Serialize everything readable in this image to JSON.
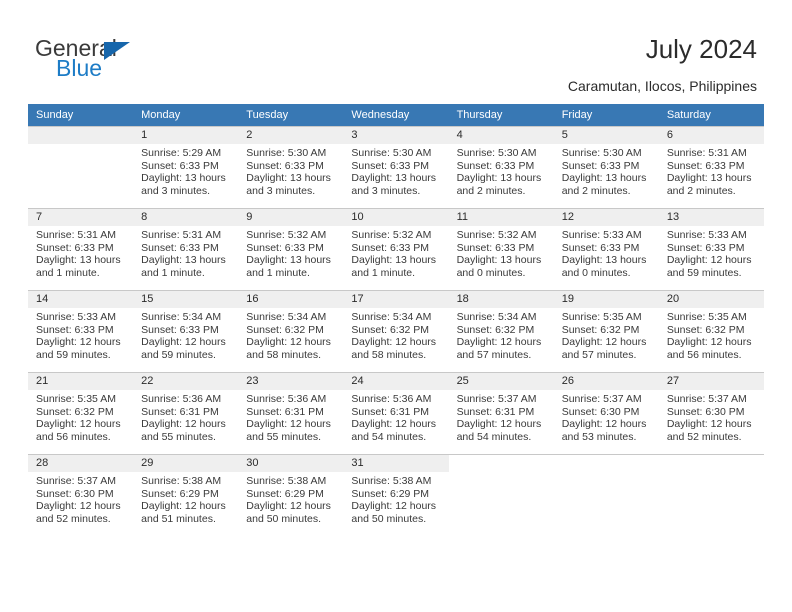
{
  "brand": {
    "name_top": "General",
    "name_bottom": "Blue",
    "color_blue": "#1d7cc6",
    "color_triangle": "#1766ab",
    "color_dark": "#3a3a3a"
  },
  "header": {
    "title": "July 2024",
    "subtitle": "Caramutan, Ilocos, Philippines"
  },
  "theme": {
    "header_bg": "#3878b4",
    "header_text": "#ffffff",
    "daynum_band": "#efefef",
    "grid_line": "#c8c8c8"
  },
  "weekday_headers": [
    "Sunday",
    "Monday",
    "Tuesday",
    "Wednesday",
    "Thursday",
    "Friday",
    "Saturday"
  ],
  "weeks": [
    [
      {
        "day": "",
        "sunrise": "",
        "sunset": "",
        "daylight_line1": "",
        "daylight_line2": ""
      },
      {
        "day": "1",
        "sunrise": "Sunrise: 5:29 AM",
        "sunset": "Sunset: 6:33 PM",
        "daylight_line1": "Daylight: 13 hours",
        "daylight_line2": "and 3 minutes."
      },
      {
        "day": "2",
        "sunrise": "Sunrise: 5:30 AM",
        "sunset": "Sunset: 6:33 PM",
        "daylight_line1": "Daylight: 13 hours",
        "daylight_line2": "and 3 minutes."
      },
      {
        "day": "3",
        "sunrise": "Sunrise: 5:30 AM",
        "sunset": "Sunset: 6:33 PM",
        "daylight_line1": "Daylight: 13 hours",
        "daylight_line2": "and 3 minutes."
      },
      {
        "day": "4",
        "sunrise": "Sunrise: 5:30 AM",
        "sunset": "Sunset: 6:33 PM",
        "daylight_line1": "Daylight: 13 hours",
        "daylight_line2": "and 2 minutes."
      },
      {
        "day": "5",
        "sunrise": "Sunrise: 5:30 AM",
        "sunset": "Sunset: 6:33 PM",
        "daylight_line1": "Daylight: 13 hours",
        "daylight_line2": "and 2 minutes."
      },
      {
        "day": "6",
        "sunrise": "Sunrise: 5:31 AM",
        "sunset": "Sunset: 6:33 PM",
        "daylight_line1": "Daylight: 13 hours",
        "daylight_line2": "and 2 minutes."
      }
    ],
    [
      {
        "day": "7",
        "sunrise": "Sunrise: 5:31 AM",
        "sunset": "Sunset: 6:33 PM",
        "daylight_line1": "Daylight: 13 hours",
        "daylight_line2": "and 1 minute."
      },
      {
        "day": "8",
        "sunrise": "Sunrise: 5:31 AM",
        "sunset": "Sunset: 6:33 PM",
        "daylight_line1": "Daylight: 13 hours",
        "daylight_line2": "and 1 minute."
      },
      {
        "day": "9",
        "sunrise": "Sunrise: 5:32 AM",
        "sunset": "Sunset: 6:33 PM",
        "daylight_line1": "Daylight: 13 hours",
        "daylight_line2": "and 1 minute."
      },
      {
        "day": "10",
        "sunrise": "Sunrise: 5:32 AM",
        "sunset": "Sunset: 6:33 PM",
        "daylight_line1": "Daylight: 13 hours",
        "daylight_line2": "and 1 minute."
      },
      {
        "day": "11",
        "sunrise": "Sunrise: 5:32 AM",
        "sunset": "Sunset: 6:33 PM",
        "daylight_line1": "Daylight: 13 hours",
        "daylight_line2": "and 0 minutes."
      },
      {
        "day": "12",
        "sunrise": "Sunrise: 5:33 AM",
        "sunset": "Sunset: 6:33 PM",
        "daylight_line1": "Daylight: 13 hours",
        "daylight_line2": "and 0 minutes."
      },
      {
        "day": "13",
        "sunrise": "Sunrise: 5:33 AM",
        "sunset": "Sunset: 6:33 PM",
        "daylight_line1": "Daylight: 12 hours",
        "daylight_line2": "and 59 minutes."
      }
    ],
    [
      {
        "day": "14",
        "sunrise": "Sunrise: 5:33 AM",
        "sunset": "Sunset: 6:33 PM",
        "daylight_line1": "Daylight: 12 hours",
        "daylight_line2": "and 59 minutes."
      },
      {
        "day": "15",
        "sunrise": "Sunrise: 5:34 AM",
        "sunset": "Sunset: 6:33 PM",
        "daylight_line1": "Daylight: 12 hours",
        "daylight_line2": "and 59 minutes."
      },
      {
        "day": "16",
        "sunrise": "Sunrise: 5:34 AM",
        "sunset": "Sunset: 6:32 PM",
        "daylight_line1": "Daylight: 12 hours",
        "daylight_line2": "and 58 minutes."
      },
      {
        "day": "17",
        "sunrise": "Sunrise: 5:34 AM",
        "sunset": "Sunset: 6:32 PM",
        "daylight_line1": "Daylight: 12 hours",
        "daylight_line2": "and 58 minutes."
      },
      {
        "day": "18",
        "sunrise": "Sunrise: 5:34 AM",
        "sunset": "Sunset: 6:32 PM",
        "daylight_line1": "Daylight: 12 hours",
        "daylight_line2": "and 57 minutes."
      },
      {
        "day": "19",
        "sunrise": "Sunrise: 5:35 AM",
        "sunset": "Sunset: 6:32 PM",
        "daylight_line1": "Daylight: 12 hours",
        "daylight_line2": "and 57 minutes."
      },
      {
        "day": "20",
        "sunrise": "Sunrise: 5:35 AM",
        "sunset": "Sunset: 6:32 PM",
        "daylight_line1": "Daylight: 12 hours",
        "daylight_line2": "and 56 minutes."
      }
    ],
    [
      {
        "day": "21",
        "sunrise": "Sunrise: 5:35 AM",
        "sunset": "Sunset: 6:32 PM",
        "daylight_line1": "Daylight: 12 hours",
        "daylight_line2": "and 56 minutes."
      },
      {
        "day": "22",
        "sunrise": "Sunrise: 5:36 AM",
        "sunset": "Sunset: 6:31 PM",
        "daylight_line1": "Daylight: 12 hours",
        "daylight_line2": "and 55 minutes."
      },
      {
        "day": "23",
        "sunrise": "Sunrise: 5:36 AM",
        "sunset": "Sunset: 6:31 PM",
        "daylight_line1": "Daylight: 12 hours",
        "daylight_line2": "and 55 minutes."
      },
      {
        "day": "24",
        "sunrise": "Sunrise: 5:36 AM",
        "sunset": "Sunset: 6:31 PM",
        "daylight_line1": "Daylight: 12 hours",
        "daylight_line2": "and 54 minutes."
      },
      {
        "day": "25",
        "sunrise": "Sunrise: 5:37 AM",
        "sunset": "Sunset: 6:31 PM",
        "daylight_line1": "Daylight: 12 hours",
        "daylight_line2": "and 54 minutes."
      },
      {
        "day": "26",
        "sunrise": "Sunrise: 5:37 AM",
        "sunset": "Sunset: 6:30 PM",
        "daylight_line1": "Daylight: 12 hours",
        "daylight_line2": "and 53 minutes."
      },
      {
        "day": "27",
        "sunrise": "Sunrise: 5:37 AM",
        "sunset": "Sunset: 6:30 PM",
        "daylight_line1": "Daylight: 12 hours",
        "daylight_line2": "and 52 minutes."
      }
    ],
    [
      {
        "day": "28",
        "sunrise": "Sunrise: 5:37 AM",
        "sunset": "Sunset: 6:30 PM",
        "daylight_line1": "Daylight: 12 hours",
        "daylight_line2": "and 52 minutes."
      },
      {
        "day": "29",
        "sunrise": "Sunrise: 5:38 AM",
        "sunset": "Sunset: 6:29 PM",
        "daylight_line1": "Daylight: 12 hours",
        "daylight_line2": "and 51 minutes."
      },
      {
        "day": "30",
        "sunrise": "Sunrise: 5:38 AM",
        "sunset": "Sunset: 6:29 PM",
        "daylight_line1": "Daylight: 12 hours",
        "daylight_line2": "and 50 minutes."
      },
      {
        "day": "31",
        "sunrise": "Sunrise: 5:38 AM",
        "sunset": "Sunset: 6:29 PM",
        "daylight_line1": "Daylight: 12 hours",
        "daylight_line2": "and 50 minutes."
      },
      {
        "day": "",
        "sunrise": "",
        "sunset": "",
        "daylight_line1": "",
        "daylight_line2": ""
      },
      {
        "day": "",
        "sunrise": "",
        "sunset": "",
        "daylight_line1": "",
        "daylight_line2": ""
      },
      {
        "day": "",
        "sunrise": "",
        "sunset": "",
        "daylight_line1": "",
        "daylight_line2": ""
      }
    ]
  ]
}
